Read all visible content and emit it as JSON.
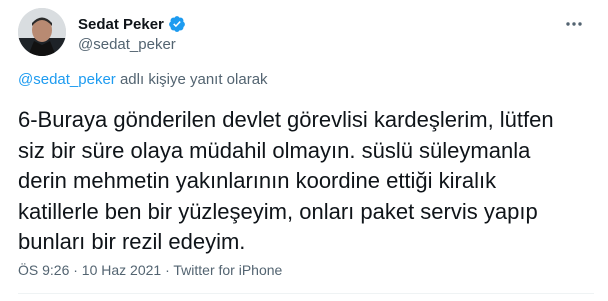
{
  "author": {
    "name": "Sedat Peker",
    "handle": "@sedat_peker"
  },
  "reply": {
    "mention": "@sedat_peker",
    "suffix": " adlı kişiye yanıt olarak"
  },
  "tweet": {
    "lines": [
      "6-Buraya gönderilen devlet görevlisi kardeşlerim, lütfen",
      "siz bir süre olaya müdahil olmayın. süslü süleymanla",
      "derin mehmetin yakınlarının koordine ettiği kiralık",
      "katillerle ben bir yüzleşeyim, onları paket servis yapıp",
      "bunları bir rezil edeyim."
    ]
  },
  "meta": {
    "text": "ÖS 9:26 · 10 Haz 2021 · Twitter for iPhone"
  },
  "colors": {
    "accent": "#1d9bf0",
    "secondary_text": "#536471",
    "primary_text": "#0f1419"
  }
}
